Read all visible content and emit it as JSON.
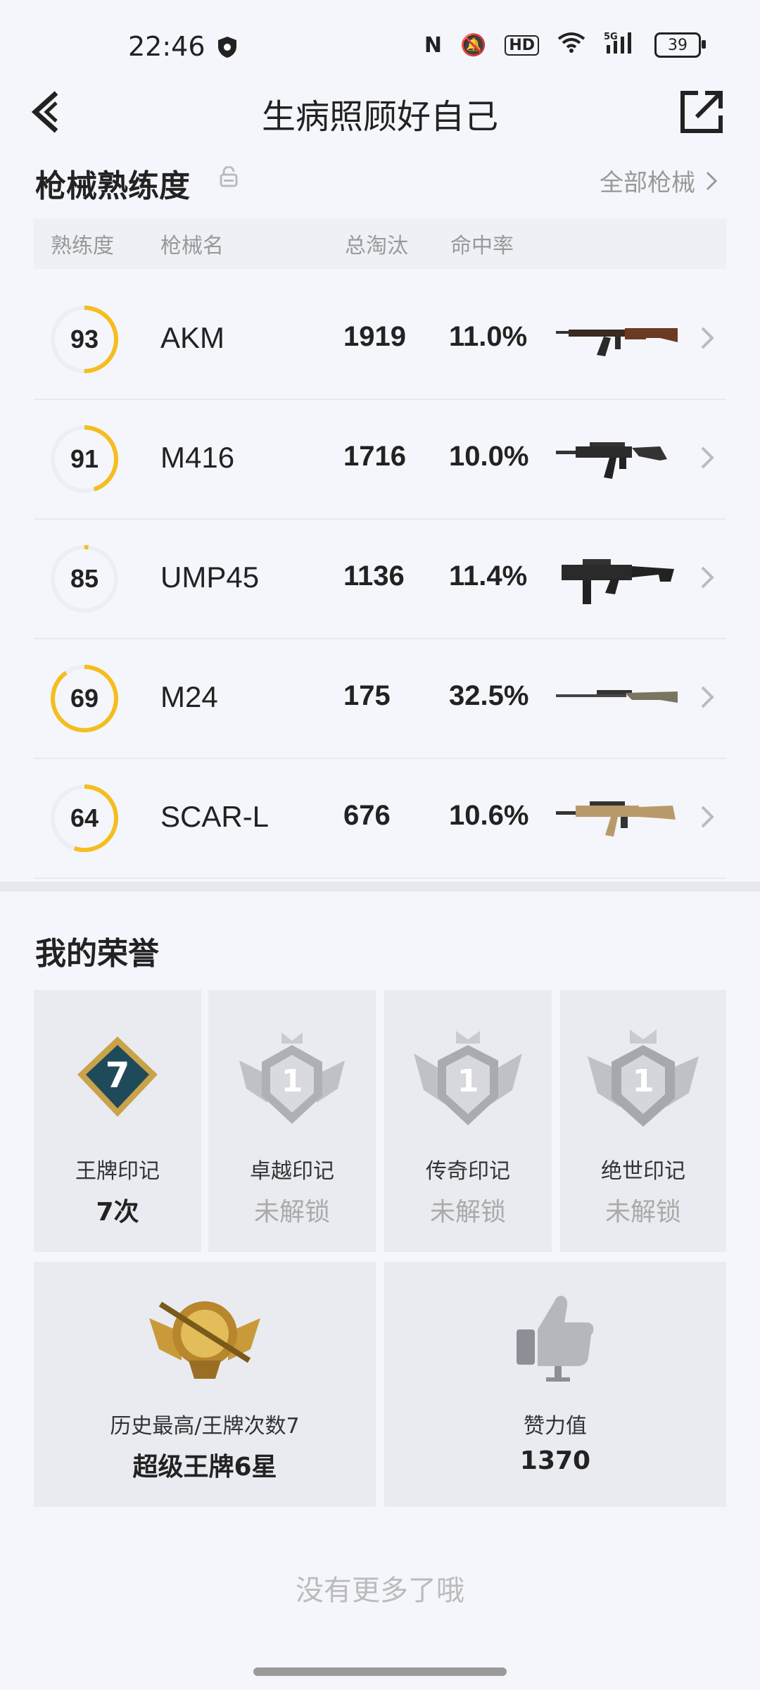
{
  "status_bar": {
    "time": "22:46",
    "battery": "39"
  },
  "nav": {
    "title": "生病照顾好自己"
  },
  "mastery": {
    "heading": "枪械熟练度",
    "all_link": "全部枪械",
    "columns": {
      "mastery": "熟练度",
      "name": "枪械名",
      "eliminations": "总淘汰",
      "hit_rate": "命中率"
    },
    "rows": [
      {
        "level": "93",
        "progress": 0.5,
        "name": "AKM",
        "eliminations": "1919",
        "hit_rate": "11.0%"
      },
      {
        "level": "91",
        "progress": 0.45,
        "name": "M416",
        "eliminations": "1716",
        "hit_rate": "10.0%"
      },
      {
        "level": "85",
        "progress": 0.02,
        "name": "UMP45",
        "eliminations": "1136",
        "hit_rate": "11.4%"
      },
      {
        "level": "69",
        "progress": 0.9,
        "name": "M24",
        "eliminations": "175",
        "hit_rate": "32.5%"
      },
      {
        "level": "64",
        "progress": 0.55,
        "name": "SCAR-L",
        "eliminations": "676",
        "hit_rate": "10.6%"
      }
    ]
  },
  "honors": {
    "heading": "我的荣誉",
    "badges": [
      {
        "label": "王牌印记",
        "value": "7次",
        "badge_number": "7"
      },
      {
        "label": "卓越印记",
        "value": "未解锁",
        "badge_number": "1"
      },
      {
        "label": "传奇印记",
        "value": "未解锁",
        "badge_number": "1"
      },
      {
        "label": "绝世印记",
        "value": "未解锁",
        "badge_number": "1"
      }
    ],
    "highest": {
      "label": "历史最高/王牌次数7",
      "value": "超级王牌6星"
    },
    "likes": {
      "label": "赞力值",
      "value": "1370"
    }
  },
  "footer": {
    "text": "没有更多了哦"
  },
  "colors": {
    "accent": "#f5bd1f",
    "track": "#eceef2",
    "background": "#f4f6fb"
  }
}
